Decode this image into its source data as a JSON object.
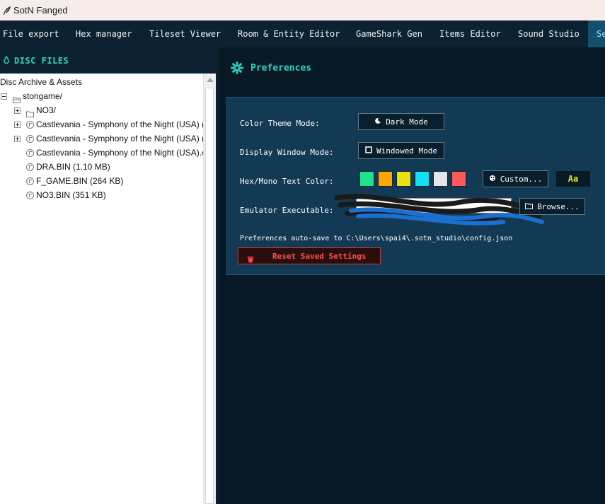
{
  "window": {
    "title": "SotN Fanged"
  },
  "tabs": [
    {
      "label": "File export"
    },
    {
      "label": "Hex manager"
    },
    {
      "label": "Tileset Viewer"
    },
    {
      "label": "Room & Entity Editor"
    },
    {
      "label": "GameShark Gen"
    },
    {
      "label": "Items Editor"
    },
    {
      "label": "Sound Studio"
    },
    {
      "label": "Se",
      "active": true
    }
  ],
  "left_panel": {
    "header": "DISC FILES",
    "tree": [
      {
        "label": "Disc Archive & Assets",
        "kind": "root"
      },
      {
        "label": "stongame/",
        "kind": "folder",
        "expanded": true
      },
      {
        "label": "NO3/",
        "kind": "folder",
        "expanded": false
      },
      {
        "label": "Castlevania - Symphony of the Night (USA) (",
        "kind": "file",
        "expandable": true
      },
      {
        "label": "Castlevania - Symphony of the Night (USA) (",
        "kind": "file",
        "expandable": true
      },
      {
        "label": "Castlevania - Symphony of the Night (USA).c",
        "kind": "file",
        "expandable": false
      },
      {
        "label": "DRA.BIN (1.10 MB)",
        "kind": "file",
        "expandable": false
      },
      {
        "label": "F_GAME.BIN (264 KB)",
        "kind": "file",
        "expandable": false
      },
      {
        "label": "NO3.BIN (351 KB)",
        "kind": "file",
        "expandable": false
      }
    ]
  },
  "preferences": {
    "header": "Preferences",
    "color_theme_label": "Color Theme Mode:",
    "color_theme_button": "Dark Mode",
    "display_window_label": "Display Window Mode:",
    "display_window_button": "Windowed Mode",
    "hex_color_label": "Hex/Mono Text Color:",
    "swatches": [
      "#1fe38a",
      "#ffa500",
      "#e8e010",
      "#10e0f0",
      "#e6e6e6",
      "#ff5a5a"
    ],
    "custom_button": "Custom...",
    "preview_text": "Aa",
    "emulator_label": "Emulator Executable:",
    "browse_button": "Browse...",
    "autosave_note": "Preferences auto-save to C:\\Users\\spai4\\.sotn_studio\\config.json",
    "reset_button": "Reset Saved Settings"
  },
  "colors": {
    "accent": "#2fd0c0",
    "panel_bg": "#071a26",
    "card_bg": "#133a55",
    "danger": "#ff5050",
    "preview_text": "#f0e020"
  }
}
